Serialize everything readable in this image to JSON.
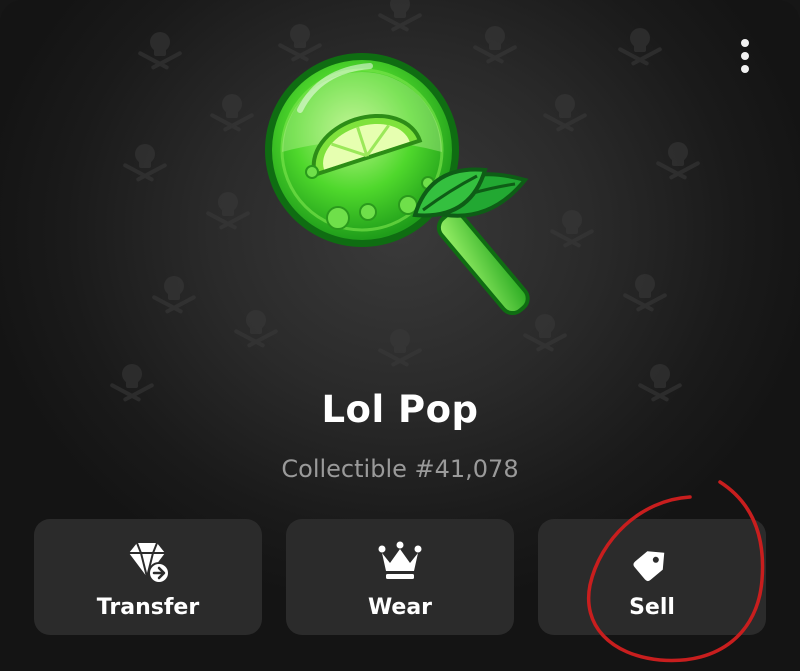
{
  "item": {
    "name": "Lol Pop",
    "subtitle": "Collectible #41,078"
  },
  "actions": [
    {
      "label": "Transfer",
      "icon": "diamond-transfer-icon"
    },
    {
      "label": "Wear",
      "icon": "crown-icon"
    },
    {
      "label": "Sell",
      "icon": "price-tag-icon"
    }
  ],
  "menu": {
    "icon": "more-vertical-icon"
  },
  "background_pattern": {
    "icon": "skull-crossbones-icon"
  },
  "colors": {
    "background": "#1a1a1a",
    "button_bg": "#2b2b2b",
    "text_primary": "#ffffff",
    "text_secondary": "#9a9a9a",
    "lollipop_green": "#3fd62a",
    "annotation_red": "#c81e1e"
  }
}
